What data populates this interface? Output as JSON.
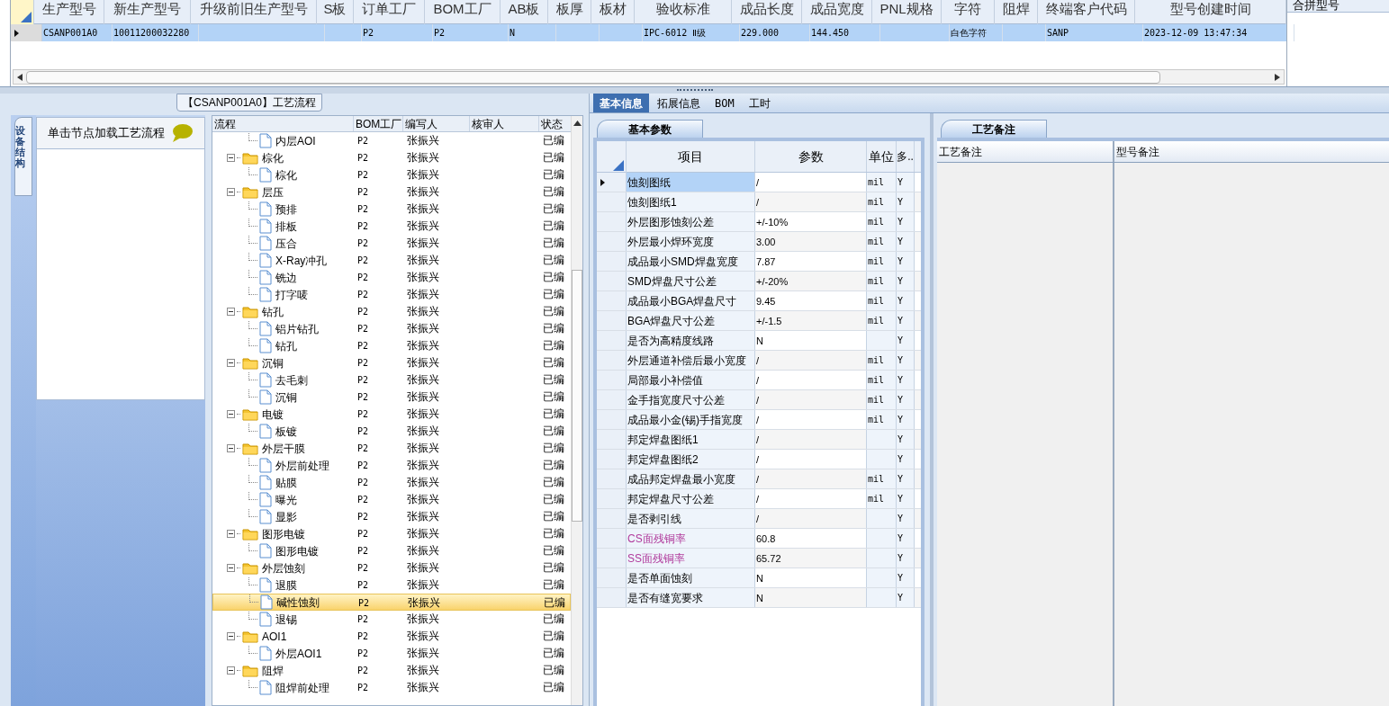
{
  "models_grid": {
    "columns": [
      "生产型号",
      "新生产型号",
      "升级前旧生产型号",
      "S板",
      "订单工厂",
      "BOM工厂",
      "AB板",
      "板厚",
      "板材",
      "验收标准",
      "成品长度",
      "成品宽度",
      "PNL规格",
      "字符",
      "阻焊",
      "终端客户代码",
      "型号创建时间"
    ],
    "rows": [
      {
        "selected": true,
        "cells": [
          "CSANP001A0",
          "10011200032280",
          "",
          "",
          "P2",
          "P2",
          "N",
          "",
          "",
          "IPC-6012 Ⅱ级",
          "229.000",
          "144.450",
          "",
          "白色字符",
          "",
          "SANP",
          "2023-12-09 13:47:34"
        ]
      }
    ]
  },
  "merge_panel": {
    "header": "合拼型号"
  },
  "process_panel": {
    "title": "【CSANP001A0】工艺流程",
    "side_tab": "设备结构",
    "hint": "单击节点加载工艺流程",
    "columns": [
      "流程",
      "BOM工厂",
      "编写人",
      "核审人",
      "状态"
    ],
    "tree": [
      {
        "children": [
          {
            "kind": "file",
            "label": "内层AOI",
            "bom": "P2",
            "author": "张振兴",
            "status": "已编",
            "selected": false
          }
        ]
      },
      {
        "kind": "folder",
        "label": "棕化",
        "bom": "P2",
        "author": "张振兴",
        "status": "已编",
        "selected": false,
        "expanded": true,
        "children": [
          {
            "kind": "file",
            "label": "棕化",
            "bom": "P2",
            "author": "张振兴",
            "status": "已编",
            "selected": false
          }
        ]
      },
      {
        "kind": "folder",
        "label": "层压",
        "bom": "P2",
        "author": "张振兴",
        "status": "已编",
        "selected": false,
        "expanded": true,
        "children": [
          {
            "kind": "file",
            "label": "预排",
            "bom": "P2",
            "author": "张振兴",
            "status": "已编",
            "selected": false
          },
          {
            "kind": "file",
            "label": "排板",
            "bom": "P2",
            "author": "张振兴",
            "status": "已编",
            "selected": false
          },
          {
            "kind": "file",
            "label": "压合",
            "bom": "P2",
            "author": "张振兴",
            "status": "已编",
            "selected": false
          },
          {
            "kind": "file",
            "label": "X-Ray冲孔",
            "bom": "P2",
            "author": "张振兴",
            "status": "已编",
            "selected": false
          },
          {
            "kind": "file",
            "label": "铣边",
            "bom": "P2",
            "author": "张振兴",
            "status": "已编",
            "selected": false
          },
          {
            "kind": "file",
            "label": "打字唛",
            "bom": "P2",
            "author": "张振兴",
            "status": "已编",
            "selected": false
          }
        ]
      },
      {
        "kind": "folder",
        "label": "钻孔",
        "bom": "P2",
        "author": "张振兴",
        "status": "已编",
        "selected": false,
        "expanded": true,
        "children": [
          {
            "kind": "file",
            "label": "铝片钻孔",
            "bom": "P2",
            "author": "张振兴",
            "status": "已编",
            "selected": false
          },
          {
            "kind": "file",
            "label": "钻孔",
            "bom": "P2",
            "author": "张振兴",
            "status": "已编",
            "selected": false
          }
        ]
      },
      {
        "kind": "folder",
        "label": "沉铜",
        "bom": "P2",
        "author": "张振兴",
        "status": "已编",
        "selected": false,
        "expanded": true,
        "children": [
          {
            "kind": "file",
            "label": "去毛刺",
            "bom": "P2",
            "author": "张振兴",
            "status": "已编",
            "selected": false
          },
          {
            "kind": "file",
            "label": "沉铜",
            "bom": "P2",
            "author": "张振兴",
            "status": "已编",
            "selected": false
          }
        ]
      },
      {
        "kind": "folder",
        "label": "电镀",
        "bom": "P2",
        "author": "张振兴",
        "status": "已编",
        "selected": false,
        "expanded": true,
        "children": [
          {
            "kind": "file",
            "label": "板镀",
            "bom": "P2",
            "author": "张振兴",
            "status": "已编",
            "selected": false
          }
        ]
      },
      {
        "kind": "folder",
        "label": "外层干膜",
        "bom": "P2",
        "author": "张振兴",
        "status": "已编",
        "selected": false,
        "expanded": true,
        "children": [
          {
            "kind": "file",
            "label": "外层前处理",
            "bom": "P2",
            "author": "张振兴",
            "status": "已编",
            "selected": false
          },
          {
            "kind": "file",
            "label": "贴膜",
            "bom": "P2",
            "author": "张振兴",
            "status": "已编",
            "selected": false
          },
          {
            "kind": "file",
            "label": "曝光",
            "bom": "P2",
            "author": "张振兴",
            "status": "已编",
            "selected": false
          },
          {
            "kind": "file",
            "label": "显影",
            "bom": "P2",
            "author": "张振兴",
            "status": "已编",
            "selected": false
          }
        ]
      },
      {
        "kind": "folder",
        "label": "图形电镀",
        "bom": "P2",
        "author": "张振兴",
        "status": "已编",
        "selected": false,
        "expanded": true,
        "children": [
          {
            "kind": "file",
            "label": "图形电镀",
            "bom": "P2",
            "author": "张振兴",
            "status": "已编",
            "selected": false
          }
        ]
      },
      {
        "kind": "folder",
        "label": "外层蚀刻",
        "bom": "P2",
        "author": "张振兴",
        "status": "已编",
        "selected": false,
        "expanded": true,
        "children": [
          {
            "kind": "file",
            "label": "退膜",
            "bom": "P2",
            "author": "张振兴",
            "status": "已编",
            "selected": false
          },
          {
            "kind": "file",
            "label": "碱性蚀刻",
            "bom": "P2",
            "author": "张振兴",
            "status": "已编",
            "selected": true
          },
          {
            "kind": "file",
            "label": "退锡",
            "bom": "P2",
            "author": "张振兴",
            "status": "已编",
            "selected": false
          }
        ]
      },
      {
        "kind": "folder",
        "label": "AOI1",
        "bom": "P2",
        "author": "张振兴",
        "status": "已编",
        "selected": false,
        "expanded": true,
        "children": [
          {
            "kind": "file",
            "label": "外层AOI1",
            "bom": "P2",
            "author": "张振兴",
            "status": "已编",
            "selected": false
          }
        ]
      },
      {
        "kind": "folder",
        "label": "阻焊",
        "bom": "P2",
        "author": "张振兴",
        "status": "已编",
        "selected": false,
        "expanded": true,
        "children": [
          {
            "kind": "file",
            "label": "阻焊前处理",
            "bom": "P2",
            "author": "张振兴",
            "status": "已编",
            "selected": false
          }
        ]
      }
    ]
  },
  "detail_tabs": [
    {
      "label": "基本信息",
      "selected": true
    },
    {
      "label": "拓展信息",
      "selected": false
    },
    {
      "label": "BOM",
      "selected": false
    },
    {
      "label": "工时",
      "selected": false
    }
  ],
  "params_panel": {
    "tab": "基本参数",
    "columns": [
      "项目",
      "参数",
      "单位",
      "多.."
    ],
    "rows": [
      {
        "item": "蚀刻图纸",
        "value": "/",
        "unit": "mil",
        "flag": "Y",
        "selected": true
      },
      {
        "item": "蚀刻图纸1",
        "value": "/",
        "unit": "mil",
        "flag": "Y",
        "selected": false
      },
      {
        "item": "外层图形蚀刻公差",
        "value": "+/-10%",
        "unit": "mil",
        "flag": "Y",
        "selected": false
      },
      {
        "item": "外层最小焊环宽度",
        "value": "3.00",
        "unit": "mil",
        "flag": "Y",
        "selected": false
      },
      {
        "item": "成品最小SMD焊盘宽度",
        "value": "7.87",
        "unit": "mil",
        "flag": "Y",
        "selected": false
      },
      {
        "item": "SMD焊盘尺寸公差",
        "value": "+/-20%",
        "unit": "mil",
        "flag": "Y",
        "selected": false
      },
      {
        "item": "成品最小BGA焊盘尺寸",
        "value": "9.45",
        "unit": "mil",
        "flag": "Y",
        "selected": false
      },
      {
        "item": "BGA焊盘尺寸公差",
        "value": "+/-1.5",
        "unit": "mil",
        "flag": "Y",
        "selected": false
      },
      {
        "item": "是否为高精度线路",
        "value": "N",
        "flag": "Y",
        "selected": false
      },
      {
        "item": "外层通道补偿后最小宽度",
        "value": "/",
        "unit": "mil",
        "flag": "Y",
        "selected": false
      },
      {
        "item": "局部最小补偿值",
        "value": "/",
        "unit": "mil",
        "flag": "Y",
        "selected": false
      },
      {
        "item": "金手指宽度尺寸公差",
        "value": "/",
        "unit": "mil",
        "flag": "Y",
        "selected": false
      },
      {
        "item": "成品最小金(锡)手指宽度",
        "value": "/",
        "unit": "mil",
        "flag": "Y",
        "selected": false
      },
      {
        "item": "邦定焊盘图纸1",
        "value": "/",
        "flag": "Y",
        "selected": false
      },
      {
        "item": "邦定焊盘图纸2",
        "value": "/",
        "flag": "Y",
        "selected": false
      },
      {
        "item": "成品邦定焊盘最小宽度",
        "value": "/",
        "unit": "mil",
        "flag": "Y",
        "selected": false
      },
      {
        "item": "邦定焊盘尺寸公差",
        "value": "/",
        "unit": "mil",
        "flag": "Y",
        "selected": false
      },
      {
        "item": "是否剥引线",
        "value": "/",
        "flag": "Y",
        "selected": false
      },
      {
        "item": "CS面残铜率",
        "value": "60.8",
        "flag": "Y",
        "selected": false,
        "color": "#b03a9c"
      },
      {
        "item": "SS面残铜率",
        "value": "65.72",
        "flag": "Y",
        "selected": false,
        "color": "#b03a9c"
      },
      {
        "item": "是否单面蚀刻",
        "value": "N",
        "flag": "Y",
        "selected": false
      },
      {
        "item": "是否有缝宽要求",
        "value": "N",
        "flag": "Y",
        "selected": false
      }
    ]
  },
  "notes_panel": {
    "tab": "工艺备注",
    "columns": [
      "工艺备注",
      "型号备注"
    ]
  }
}
